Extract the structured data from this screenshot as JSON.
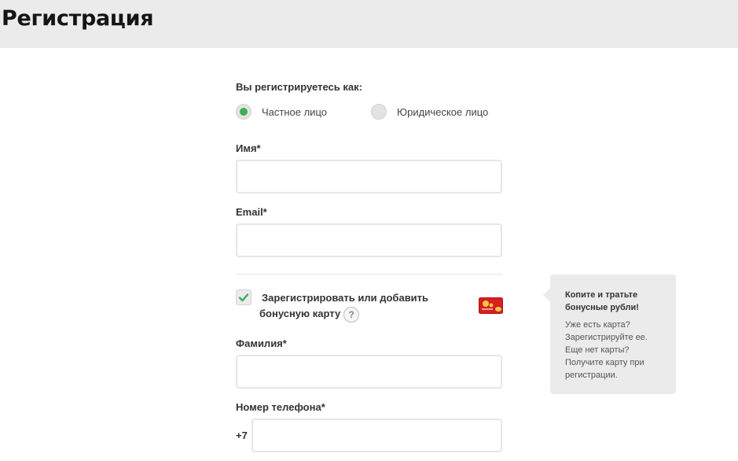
{
  "header": {
    "title": "Регистрация"
  },
  "form": {
    "register_as_label": "Вы регистрируетесь как:",
    "radios": [
      {
        "label": "Частное лицо",
        "checked": true
      },
      {
        "label": "Юридическое лицо",
        "checked": false
      }
    ],
    "first_name": {
      "label": "Имя*",
      "value": "",
      "placeholder": ""
    },
    "email": {
      "label": "Email*",
      "value": "",
      "placeholder": ""
    },
    "bonus_card": {
      "checked": true,
      "label_line1": "Зарегистрировать или добавить",
      "label_line2": "бонусную карту",
      "help": "?"
    },
    "last_name": {
      "label": "Фамилия*",
      "value": "",
      "placeholder": ""
    },
    "phone": {
      "label": "Номер телефона*",
      "prefix": "+7",
      "value": "",
      "placeholder": ""
    }
  },
  "tooltip": {
    "title_line1": "Копите и тратьте",
    "title_line2": "бонусные рубли!",
    "lines": [
      "Уже есть карта?",
      "Зарегистрируйте ее.",
      "Еще нет карты?",
      "Получите карту при",
      "регистрации."
    ]
  },
  "colors": {
    "accent_green": "#3fae55",
    "header_bg": "#ebebeb",
    "card_red": "#d42020"
  },
  "icons": {
    "check": "checkmark-icon",
    "help": "question-icon",
    "card": "bonus-card-icon"
  }
}
